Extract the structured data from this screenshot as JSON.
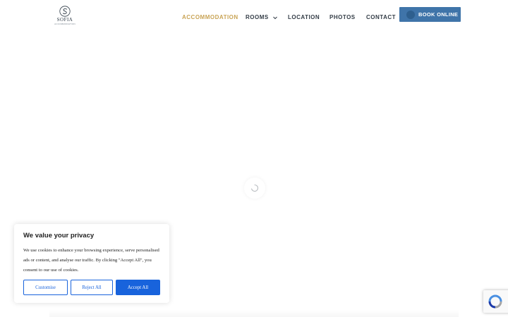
{
  "brand": {
    "name": "SOFIA",
    "subtitle": "ACCOMMODATION"
  },
  "nav": {
    "items": [
      {
        "label": "ACCOMMODATION",
        "active": true
      },
      {
        "label": "ROOMS",
        "has_dropdown": true
      },
      {
        "label": "LOCATION"
      },
      {
        "label": "PHOTOS"
      },
      {
        "label": "CONTACT"
      }
    ],
    "book_button": "BOOK ONLINE"
  },
  "loader": {
    "icon": "spinner-icon"
  },
  "cookie_banner": {
    "title": "We value your privacy",
    "text": "We use cookies to enhance your browsing experience, serve personalised ads or content, and analyse our traffic. By clicking \"Accept All\", you consent to our use of cookies.",
    "customise_label": "Customise",
    "reject_label": "Reject All",
    "accept_label": "Accept All"
  },
  "colors": {
    "accent_gold": "#c9a456",
    "book_button": "#3f74a9",
    "cookie_primary": "#1863dc",
    "nav_text": "#333c46"
  },
  "recaptcha": {
    "icon": "recaptcha-icon"
  }
}
